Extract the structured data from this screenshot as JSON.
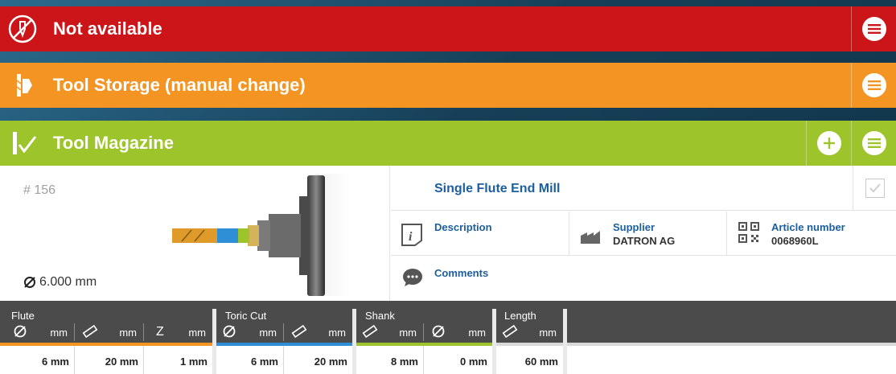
{
  "bars": {
    "not_available": {
      "title": "Not available",
      "color": "#cc1519"
    },
    "storage": {
      "title": "Tool Storage (manual change)",
      "color": "#f39423"
    },
    "magazine": {
      "title": "Tool Magazine",
      "color": "#9dc42a"
    }
  },
  "tool": {
    "number": "# 156",
    "diameter": "6.000 mm",
    "name": "Single Flute End Mill",
    "description_label": "Description",
    "supplier_label": "Supplier",
    "supplier_value": "DATRON AG",
    "article_label": "Article number",
    "article_value": "0068960L",
    "comments_label": "Comments"
  },
  "params": {
    "groups": [
      "Flute",
      "Toric Cut",
      "Shank",
      "Length"
    ],
    "units": [
      "mm",
      "mm",
      "mm",
      "mm",
      "mm",
      "mm",
      "mm",
      "mm"
    ],
    "z_label": "Z",
    "values": [
      "6 mm",
      "20 mm",
      "1 mm",
      "6 mm",
      "20 mm",
      "8 mm",
      "0 mm",
      "60 mm"
    ],
    "colors": {
      "flute": "#f39423",
      "toric": "#2e8fd6",
      "shank": "#9dc42a",
      "length": "#d9d9d9"
    }
  }
}
